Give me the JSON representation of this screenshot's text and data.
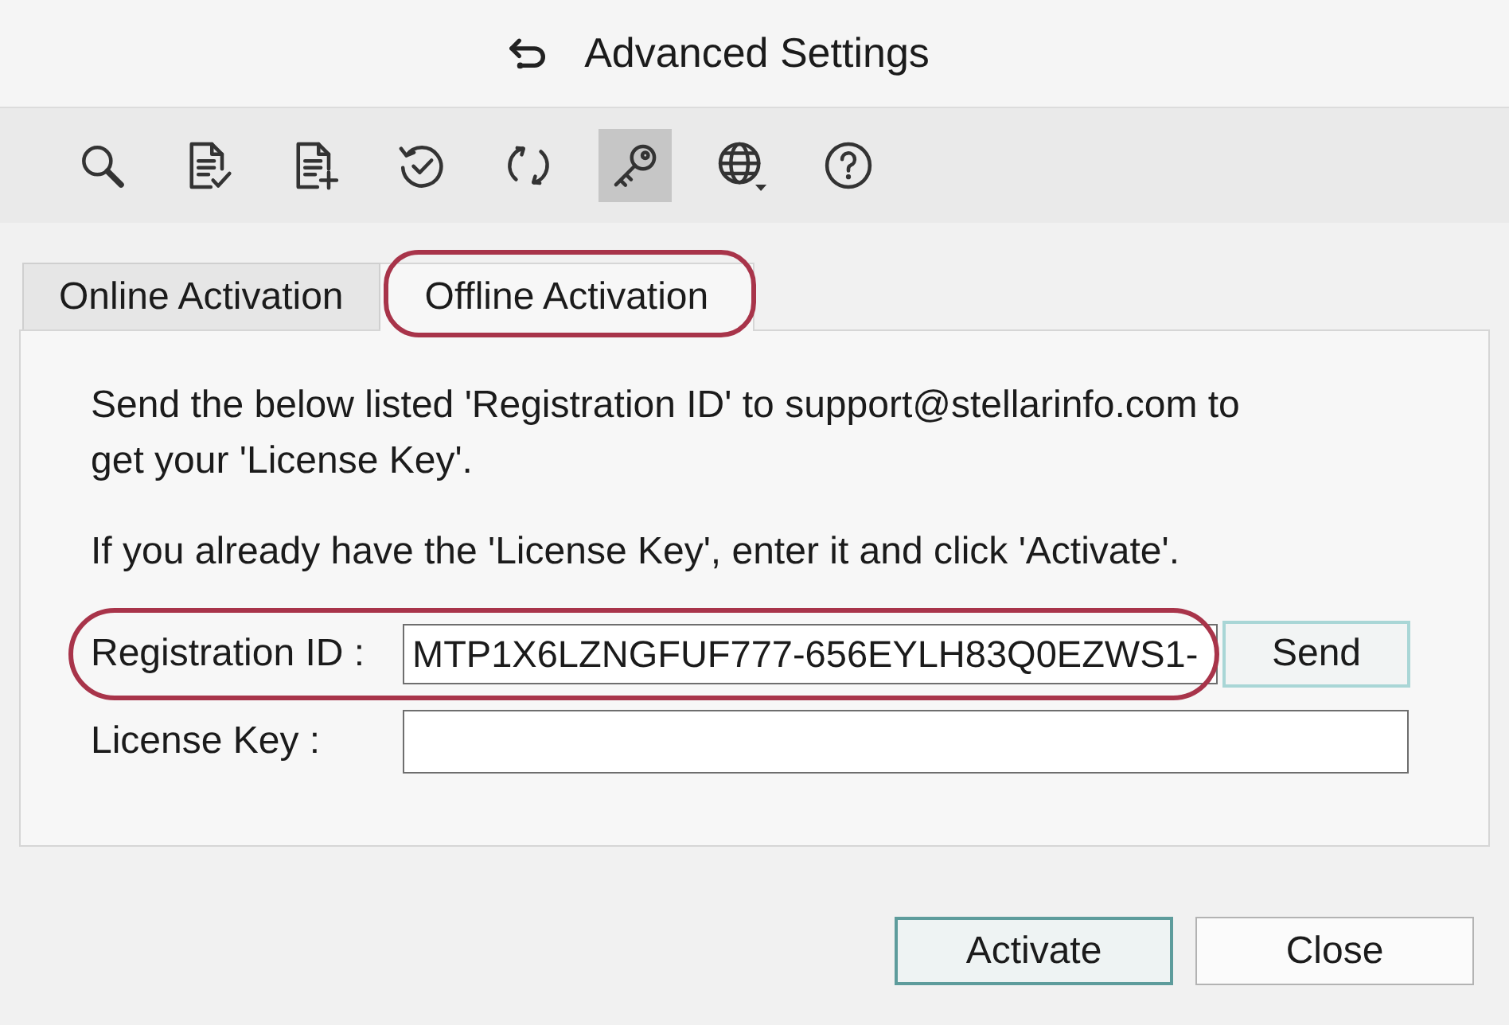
{
  "window": {
    "title": "Advanced Settings"
  },
  "toolbar": {
    "items": [
      {
        "kind": "search",
        "selected": false
      },
      {
        "kind": "document_check",
        "selected": false
      },
      {
        "kind": "document_add",
        "selected": false
      },
      {
        "kind": "history_check",
        "selected": false
      },
      {
        "kind": "refresh",
        "selected": false
      },
      {
        "kind": "key",
        "selected": true
      },
      {
        "kind": "globe",
        "selected": false
      },
      {
        "kind": "help",
        "selected": false
      }
    ]
  },
  "tabs": [
    {
      "label": "Online Activation",
      "selected": false,
      "highlighted": false
    },
    {
      "label": "Offline Activation",
      "selected": true,
      "highlighted": true
    }
  ],
  "panel": {
    "paragraphs": [
      "Send the below listed 'Registration ID' to support@stellarinfo.com to get your 'License Key'.",
      "If you already have the 'License Key', enter it and click 'Activate'."
    ],
    "fields": [
      {
        "label": "Registration ID :",
        "value": "MTP1X6LZNGFUF777-656EYLH83Q0EZWS1-",
        "button": "Send",
        "highlighted": true
      },
      {
        "label": "License Key :",
        "highlighted": false
      }
    ]
  },
  "buttons": [
    {
      "label": "Activate",
      "default": true
    },
    {
      "label": "Close",
      "default": false
    }
  ]
}
